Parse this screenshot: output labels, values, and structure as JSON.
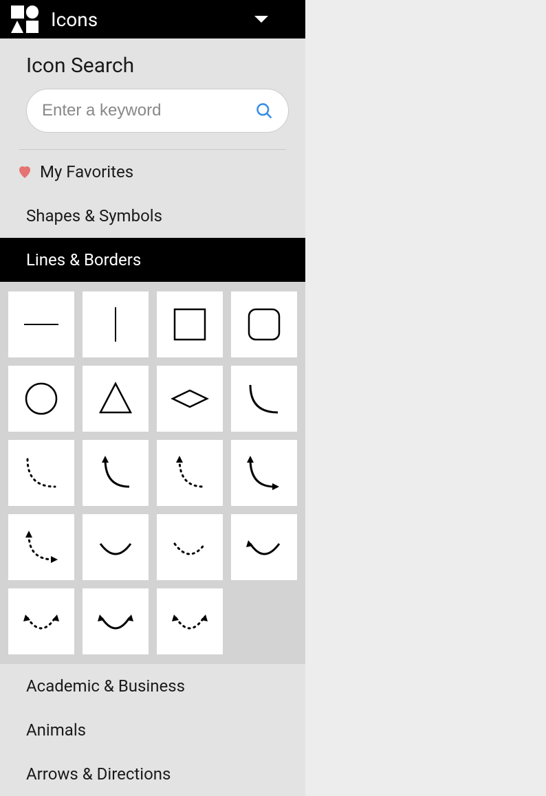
{
  "header": {
    "title": "Icons"
  },
  "search": {
    "heading": "Icon Search",
    "placeholder": "Enter a keyword"
  },
  "favorites": {
    "label": "My Favorites"
  },
  "categories": [
    {
      "label": "Shapes & Symbols",
      "active": false
    },
    {
      "label": "Lines & Borders",
      "active": true
    },
    {
      "label": "Academic & Business",
      "active": false
    },
    {
      "label": "Animals",
      "active": false
    },
    {
      "label": "Arrows & Directions",
      "active": false
    }
  ],
  "iconTiles": [
    "horizontal-line",
    "vertical-line",
    "square",
    "rounded-square",
    "circle",
    "triangle",
    "diamond",
    "curve",
    "dotted-curve",
    "arrow-curve-left",
    "dotted-arrow-curve-left",
    "arrow-curve-right",
    "dotted-arc-arrows",
    "arc",
    "dotted-arc",
    "arc-arrow-left",
    "dotted-arc-double-arrow",
    "arc-double-arrow",
    "dotted-arc-double-arrow-2"
  ]
}
